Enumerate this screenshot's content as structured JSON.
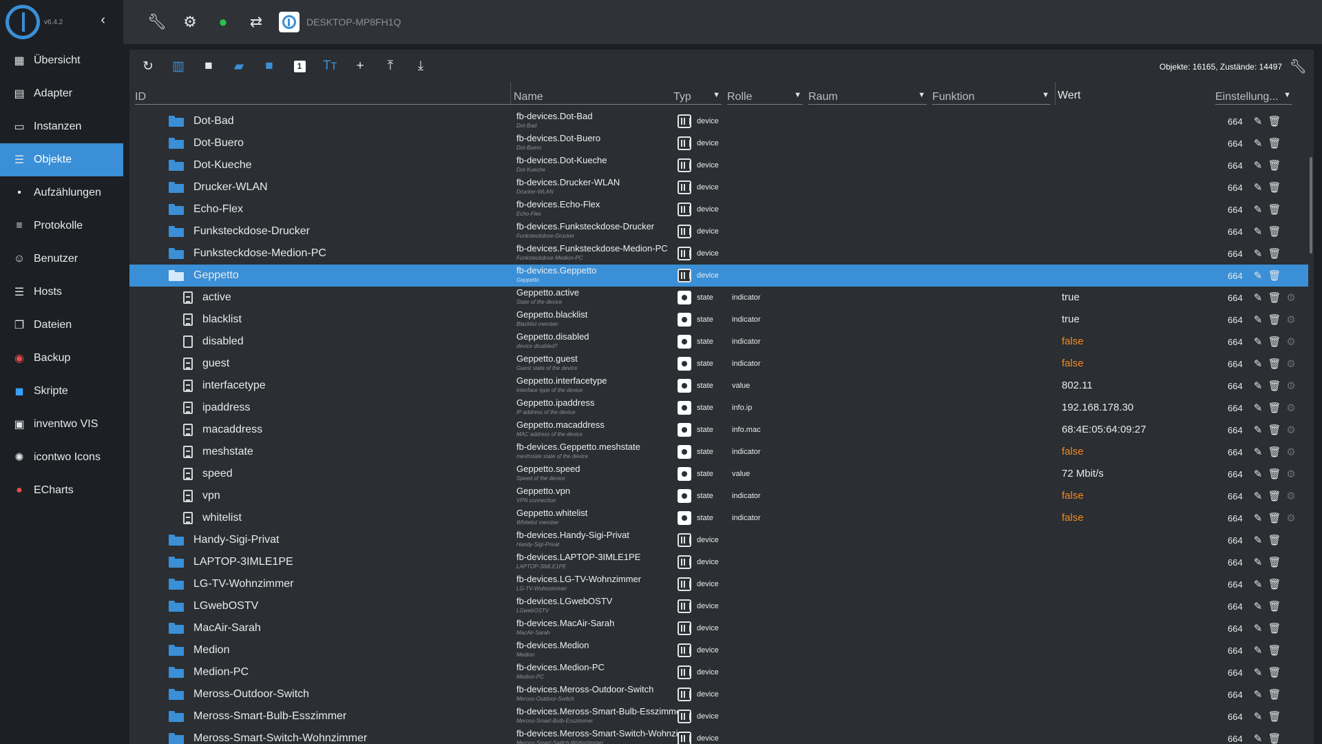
{
  "app": {
    "version": "v6.4.2",
    "host": "DESKTOP-MP8FH1Q"
  },
  "sidebar": {
    "items": [
      {
        "label": "Übersicht",
        "icon": "grid-icon"
      },
      {
        "label": "Adapter",
        "icon": "store-icon"
      },
      {
        "label": "Instanzen",
        "icon": "instances-icon"
      },
      {
        "label": "Objekte",
        "icon": "list-icon",
        "active": true
      },
      {
        "label": "Aufzählungen",
        "icon": "enum-icon"
      },
      {
        "label": "Protokolle",
        "icon": "log-icon"
      },
      {
        "label": "Benutzer",
        "icon": "user-icon"
      },
      {
        "label": "Hosts",
        "icon": "hosts-icon"
      },
      {
        "label": "Dateien",
        "icon": "files-icon"
      },
      {
        "label": "Backup",
        "icon": "backup-icon"
      },
      {
        "label": "Skripte",
        "icon": "scripts-icon"
      },
      {
        "label": "inventwo VIS",
        "icon": "vis-icon"
      },
      {
        "label": "icontwo Icons",
        "icon": "icons-icon"
      },
      {
        "label": "ECharts",
        "icon": "echarts-icon"
      }
    ]
  },
  "toolbar": {
    "stats": "Objekte: 16165, Zustände: 14497",
    "number_badge": "1"
  },
  "columns": {
    "id": "ID",
    "name": "Name",
    "type": "Typ",
    "role": "Rolle",
    "room": "Raum",
    "function": "Funktion",
    "value": "Wert",
    "settings": "Einstellung..."
  },
  "rows": [
    {
      "id": "Dot-Bad",
      "name": "fb-devices.Dot-Bad",
      "sub": "Dot-Bad",
      "type": "device",
      "acl": "664"
    },
    {
      "id": "Dot-Buero",
      "name": "fb-devices.Dot-Buero",
      "sub": "Dot-Buero",
      "type": "device",
      "acl": "664"
    },
    {
      "id": "Dot-Kueche",
      "name": "fb-devices.Dot-Kueche",
      "sub": "Dot-Kueche",
      "type": "device",
      "acl": "664"
    },
    {
      "id": "Drucker-WLAN",
      "name": "fb-devices.Drucker-WLAN",
      "sub": "Drucker-WLAN",
      "type": "device",
      "acl": "664"
    },
    {
      "id": "Echo-Flex",
      "name": "fb-devices.Echo-Flex",
      "sub": "Echo-Flex",
      "type": "device",
      "acl": "664"
    },
    {
      "id": "Funksteckdose-Drucker",
      "name": "fb-devices.Funksteckdose-Drucker",
      "sub": "Funksteckdose-Drucker",
      "type": "device",
      "acl": "664"
    },
    {
      "id": "Funksteckdose-Medion-PC",
      "name": "fb-devices.Funksteckdose-Medion-PC",
      "sub": "Funksteckdose-Medion-PC",
      "type": "device",
      "acl": "664"
    },
    {
      "id": "Geppetto",
      "name": "fb-devices.Geppetto",
      "sub": "Geppetto",
      "type": "device",
      "acl": "664"
    },
    {
      "id": "active",
      "name": "Geppetto.active",
      "sub": "State of the device",
      "type": "state",
      "role": "indicator",
      "value": "true",
      "acl": "664"
    },
    {
      "id": "blacklist",
      "name": "Geppetto.blacklist",
      "sub": "Blacklist member",
      "type": "state",
      "role": "indicator",
      "value": "true",
      "acl": "664"
    },
    {
      "id": "disabled",
      "name": "Geppetto.disabled",
      "sub": "device disabled?",
      "type": "state",
      "role": "indicator",
      "value": "false",
      "acl": "664"
    },
    {
      "id": "guest",
      "name": "Geppetto.guest",
      "sub": "Guest state of the device",
      "type": "state",
      "role": "indicator",
      "value": "false",
      "acl": "664"
    },
    {
      "id": "interfacetype",
      "name": "Geppetto.interfacetype",
      "sub": "Interface type of the device",
      "type": "state",
      "role": "value",
      "value": "802.11",
      "acl": "664"
    },
    {
      "id": "ipaddress",
      "name": "Geppetto.ipaddress",
      "sub": "IP address of the device",
      "type": "state",
      "role": "info.ip",
      "value": "192.168.178.30",
      "acl": "664"
    },
    {
      "id": "macaddress",
      "name": "Geppetto.macaddress",
      "sub": "MAC address of the device",
      "type": "state",
      "role": "info.mac",
      "value": "68:4E:05:64:09:27",
      "acl": "664"
    },
    {
      "id": "meshstate",
      "name": "fb-devices.Geppetto.meshstate",
      "sub": "meshstate state of the device",
      "type": "state",
      "role": "indicator",
      "value": "false",
      "acl": "664"
    },
    {
      "id": "speed",
      "name": "Geppetto.speed",
      "sub": "Speed of the device",
      "type": "state",
      "role": "value",
      "value": "72 Mbit/s",
      "acl": "664"
    },
    {
      "id": "vpn",
      "name": "Geppetto.vpn",
      "sub": "VPN connection",
      "type": "state",
      "role": "indicator",
      "value": "false",
      "acl": "664"
    },
    {
      "id": "whitelist",
      "name": "Geppetto.whitelist",
      "sub": "Whitelist member",
      "type": "state",
      "role": "indicator",
      "value": "false",
      "acl": "664"
    },
    {
      "id": "Handy-Sigi-Privat",
      "name": "fb-devices.Handy-Sigi-Privat",
      "sub": "Handy-Sigi-Privat",
      "type": "device",
      "acl": "664"
    },
    {
      "id": "LAPTOP-3IMLE1PE",
      "name": "fb-devices.LAPTOP-3IMLE1PE",
      "sub": "LAPTOP-3IMLE1PE",
      "type": "device",
      "acl": "664"
    },
    {
      "id": "LG-TV-Wohnzimmer",
      "name": "fb-devices.LG-TV-Wohnzimmer",
      "sub": "LG-TV-Wohnzimmer",
      "type": "device",
      "acl": "664"
    },
    {
      "id": "LGwebOSTV",
      "name": "fb-devices.LGwebOSTV",
      "sub": "LGwebOSTV",
      "type": "device",
      "acl": "664"
    },
    {
      "id": "MacAir-Sarah",
      "name": "fb-devices.MacAir-Sarah",
      "sub": "MacAir-Sarah",
      "type": "device",
      "acl": "664"
    },
    {
      "id": "Medion",
      "name": "fb-devices.Medion",
      "sub": "Medion",
      "type": "device",
      "acl": "664"
    },
    {
      "id": "Medion-PC",
      "name": "fb-devices.Medion-PC",
      "sub": "Medion-PC",
      "type": "device",
      "acl": "664"
    },
    {
      "id": "Meross-Outdoor-Switch",
      "name": "fb-devices.Meross-Outdoor-Switch",
      "sub": "Meross-Outdoor-Switch",
      "type": "device",
      "acl": "664"
    },
    {
      "id": "Meross-Smart-Bulb-Esszimmer",
      "name": "fb-devices.Meross-Smart-Bulb-Esszimmer",
      "sub": "Meross-Smart-Bulb-Esszimmer",
      "type": "device",
      "acl": "664"
    },
    {
      "id": "Meross-Smart-Switch-Wohnzimmer",
      "name": "fb-devices.Meross-Smart-Switch-Wohnzimmer",
      "sub": "Meross-Smart-Switch-Wohnzimmer",
      "type": "device",
      "acl": "664"
    }
  ]
}
